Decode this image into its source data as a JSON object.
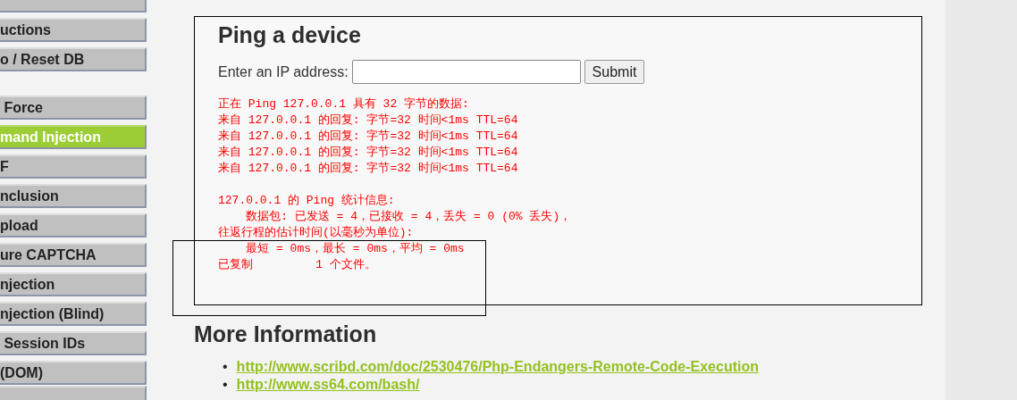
{
  "sidebar": {
    "groups": [
      {
        "items": [
          {
            "label": "uctions",
            "selected": false
          },
          {
            "label": "o / Reset DB",
            "selected": false
          }
        ]
      },
      {
        "items": [
          {
            "label": " Force",
            "selected": false
          },
          {
            "label": "mand Injection",
            "selected": true
          },
          {
            "label": "F",
            "selected": false
          },
          {
            "label": "nclusion",
            "selected": false
          },
          {
            "label": "pload",
            "selected": false
          },
          {
            "label": "ure CAPTCHA",
            "selected": false
          },
          {
            "label": "njection",
            "selected": false
          },
          {
            "label": "njection (Blind)",
            "selected": false
          },
          {
            "label": " Session IDs",
            "selected": false
          },
          {
            "label": "(DOM)",
            "selected": false
          }
        ]
      }
    ]
  },
  "panel": {
    "title": "Ping a device",
    "ip_label": "Enter an IP address:",
    "submit": "Submit",
    "output_blocks": [
      [
        "正在 Ping 127.0.0.1 具有 32 字节的数据:",
        "来自 127.0.0.1 的回复: 字节=32 时间<1ms TTL=64",
        "来自 127.0.0.1 的回复: 字节=32 时间<1ms TTL=64",
        "来自 127.0.0.1 的回复: 字节=32 时间<1ms TTL=64",
        "来自 127.0.0.1 的回复: 字节=32 时间<1ms TTL=64"
      ],
      [
        "127.0.0.1 的 Ping 统计信息:",
        "    数据包: 已发送 = 4，已接收 = 4，丢失 = 0 (0% 丢失)，",
        "往返行程的估计时间(以毫秒为单位):",
        "    最短 = 0ms，最长 = 0ms，平均 = 0ms",
        "已复制         1 个文件。"
      ]
    ]
  },
  "more_info": {
    "title": "More Information",
    "links": [
      {
        "bullet": "•",
        "url": "http://www.scribd.com/doc/2530476/Php-Endangers-Remote-Code-Execution"
      },
      {
        "bullet": "•",
        "url": "http://www.ss64.com/bash/"
      }
    ]
  }
}
